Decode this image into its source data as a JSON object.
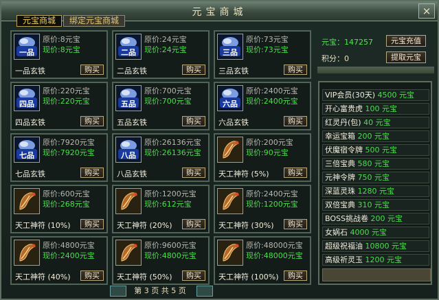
{
  "window": {
    "title": "元宝商城",
    "close_label": "×"
  },
  "tabs": [
    {
      "label": "元宝商城",
      "active": true
    },
    {
      "label": "绑定元宝商城",
      "active": false
    }
  ],
  "orig_prefix": "原价:",
  "cur_prefix": "现价:",
  "buy_label": "购买",
  "items": [
    {
      "name": "一品玄铁",
      "orig": "8元宝",
      "cur": "8元宝",
      "icon": "iron-1-icon",
      "glyph": "一品"
    },
    {
      "name": "二品玄铁",
      "orig": "24元宝",
      "cur": "24元宝",
      "icon": "iron-2-icon",
      "glyph": "二品"
    },
    {
      "name": "三品玄铁",
      "orig": "73元宝",
      "cur": "73元宝",
      "icon": "iron-3-icon",
      "glyph": "三品"
    },
    {
      "name": "四品玄铁",
      "orig": "220元宝",
      "cur": "220元宝",
      "icon": "iron-4-icon",
      "glyph": "四品"
    },
    {
      "name": "五品玄铁",
      "orig": "700元宝",
      "cur": "700元宝",
      "icon": "iron-5-icon",
      "glyph": "五品"
    },
    {
      "name": "六品玄铁",
      "orig": "2400元宝",
      "cur": "2400元宝",
      "icon": "iron-6-icon",
      "glyph": "六品"
    },
    {
      "name": "七品玄铁",
      "orig": "7920元宝",
      "cur": "7920元宝",
      "icon": "iron-7-icon",
      "glyph": "七品"
    },
    {
      "name": "八品玄铁",
      "orig": "26136元宝",
      "cur": "26136元宝",
      "icon": "iron-8-icon",
      "glyph": "八品"
    },
    {
      "name": "天工神符 (5%)",
      "orig": "200元宝",
      "cur": "90元宝",
      "icon": "scroll-icon",
      "glyph": ""
    },
    {
      "name": "天工神符 (10%)",
      "orig": "600元宝",
      "cur": "268元宝",
      "icon": "scroll-icon",
      "glyph": ""
    },
    {
      "name": "天工神符 (20%)",
      "orig": "1200元宝",
      "cur": "612元宝",
      "icon": "scroll-icon",
      "glyph": ""
    },
    {
      "name": "天工神符 (30%)",
      "orig": "2400元宝",
      "cur": "1200元宝",
      "icon": "scroll-icon",
      "glyph": ""
    },
    {
      "name": "天工神符 (40%)",
      "orig": "4800元宝",
      "cur": "2400元宝",
      "icon": "scroll-icon",
      "glyph": ""
    },
    {
      "name": "天工神符 (50%)",
      "orig": "9600元宝",
      "cur": "4800元宝",
      "icon": "scroll-icon",
      "glyph": ""
    },
    {
      "name": "天工神符 (100%)",
      "orig": "48000元宝",
      "cur": "48000元宝",
      "icon": "scroll-icon",
      "glyph": ""
    }
  ],
  "pagination": {
    "text": "第 3 页 共 5 页"
  },
  "account": {
    "ingot_label": "元宝：",
    "ingot_value": "147257",
    "score_label": "积分：",
    "score_value": "0",
    "recharge_label": "元宝充值",
    "withdraw_label": "提取元宝"
  },
  "vip_list": [
    {
      "name": "VIP会员(30天)",
      "price": "4500 元宝"
    },
    {
      "name": "开心富贵虎",
      "price": "100 元宝"
    },
    {
      "name": "红灵丹(包)",
      "price": "40 元宝"
    },
    {
      "name": "幸运宝箱",
      "price": "200 元宝"
    },
    {
      "name": "伏魔宿令牌",
      "price": "500 元宝"
    },
    {
      "name": "三倍宝典",
      "price": "580 元宝"
    },
    {
      "name": "元神令牌",
      "price": "750 元宝"
    },
    {
      "name": "深蓝灵珠",
      "price": "1280 元宝"
    },
    {
      "name": "双倍宝典",
      "price": "310 元宝"
    },
    {
      "name": "BOSS挑战卷",
      "price": "200 元宝"
    },
    {
      "name": "女娲石",
      "price": "4000 元宝"
    },
    {
      "name": "超级祝福油",
      "price": "10800 元宝"
    },
    {
      "name": "高级祈灵玉",
      "price": "1200 元宝"
    }
  ],
  "colors": {
    "price_green": "#49e04a",
    "tab_gold": "#f2d15a",
    "frame": "#5d6f61"
  }
}
